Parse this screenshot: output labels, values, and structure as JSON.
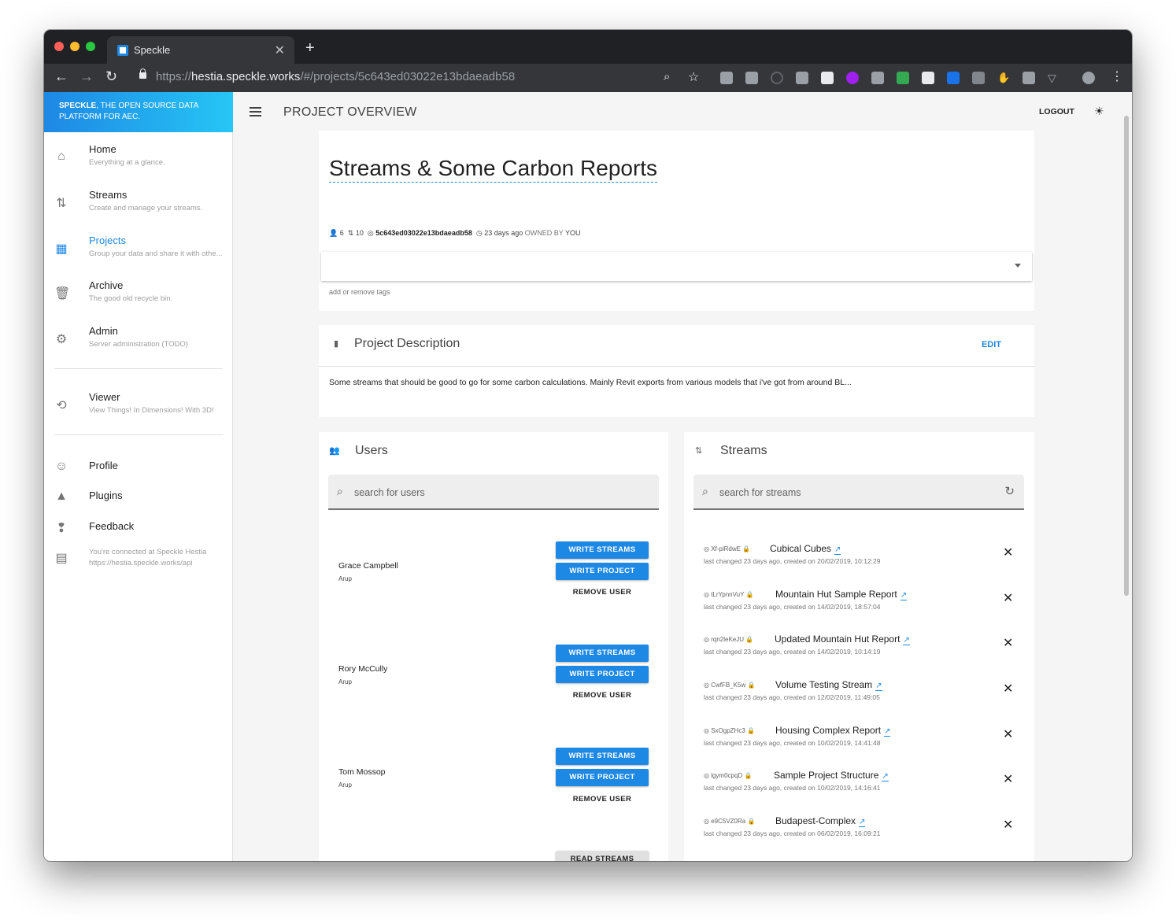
{
  "browser": {
    "tab_title": "Speckle",
    "url_scheme": "https://",
    "url_host": "hestia.speckle.works",
    "url_path": "/#/projects/5c643ed03022e13bdaeadb58"
  },
  "sidebar": {
    "brand_bold": "SPECKLE",
    "brand_text": ", THE OPEN SOURCE DATA PLATFORM FOR AEC.",
    "items": [
      {
        "title": "Home",
        "sub": "Everything at a glance.",
        "icon": "home-icon"
      },
      {
        "title": "Streams",
        "sub": "Create and manage your streams.",
        "icon": "swap-vertical-icon"
      },
      {
        "title": "Projects",
        "sub": "Group your data and share it with othe...",
        "icon": "building-icon"
      },
      {
        "title": "Archive",
        "sub": "The good old recycle bin.",
        "icon": "trash-icon"
      },
      {
        "title": "Admin",
        "sub": "Server administration (TODO)",
        "icon": "gear-icon"
      },
      {
        "title": "Viewer",
        "sub": "View Things! In Dimensions! With 3D!",
        "icon": "rotate-3d-icon"
      },
      {
        "title": "Profile",
        "icon": "face-icon"
      },
      {
        "title": "Plugins",
        "icon": "shapes-icon"
      },
      {
        "title": "Feedback",
        "icon": "feedback-icon"
      }
    ],
    "connected_line1": "You're connected at Speckle Hestia",
    "connected_line2": "https://hestia.speckle.works/api"
  },
  "header": {
    "title": "PROJECT OVERVIEW",
    "logout": "LOGOUT"
  },
  "project": {
    "name": "Streams & Some Carbon Reports",
    "user_count": "6",
    "stream_count": "10",
    "id": "5c643ed03022e13bdaeadb58",
    "age": "23 days ago",
    "owned_by_label": "OWNED BY",
    "owner": "YOU",
    "tags_hint": "add or remove tags"
  },
  "description": {
    "title": "Project Description",
    "edit": "EDIT",
    "text": "Some streams that should be good to go for some carbon calculations. Mainly Revit exports from various models that i've got from around BL..."
  },
  "users_panel": {
    "title": "Users",
    "search_placeholder": "search for users",
    "users": [
      {
        "name": "Grace Campbell",
        "org": "Arup"
      },
      {
        "name": "Rory McCully",
        "org": "Arup"
      },
      {
        "name": "Tom Mossop",
        "org": "Arup"
      }
    ],
    "write_streams": "WRITE STREAMS",
    "write_project": "WRITE PROJECT",
    "remove_user": "REMOVE USER",
    "read_streams": "READ STREAMS"
  },
  "streams_panel": {
    "title": "Streams",
    "search_placeholder": "search for streams",
    "streams": [
      {
        "id": "Xf-piRdwE",
        "name": "Cubical Cubes",
        "sub": "last changed 23 days ago, created on 20/02/2019, 10:12:29"
      },
      {
        "id": "tLrYpnnVuY",
        "name": "Mountain Hut Sample Report",
        "sub": "last changed 23 days ago, created on 14/02/2019, 18:57:04"
      },
      {
        "id": "rqn2leKeJU",
        "name": "Updated Mountain Hut Report",
        "sub": "last changed 23 days ago, created on 14/02/2019, 10:14:19"
      },
      {
        "id": "CwfFB_K5w",
        "name": "Volume Testing Stream",
        "sub": "last changed 23 days ago, created on 12/02/2019, 11:49:05"
      },
      {
        "id": "SxOgpZHc3",
        "name": "Housing Complex Report",
        "sub": "last changed 23 days ago, created on 10/02/2019, 14:41:48"
      },
      {
        "id": "lgym0cpqD",
        "name": "Sample Project Structure",
        "sub": "last changed 23 days ago, created on 10/02/2019, 14:16:41"
      },
      {
        "id": "e9C5VZ0Ra",
        "name": "Budapest-Complex",
        "sub": "last changed 23 days ago, created on 06/02/2019, 16:09:21"
      }
    ]
  },
  "colors": {
    "accent": "#1e88e5",
    "brand_gradient_end": "#26c6f5"
  }
}
